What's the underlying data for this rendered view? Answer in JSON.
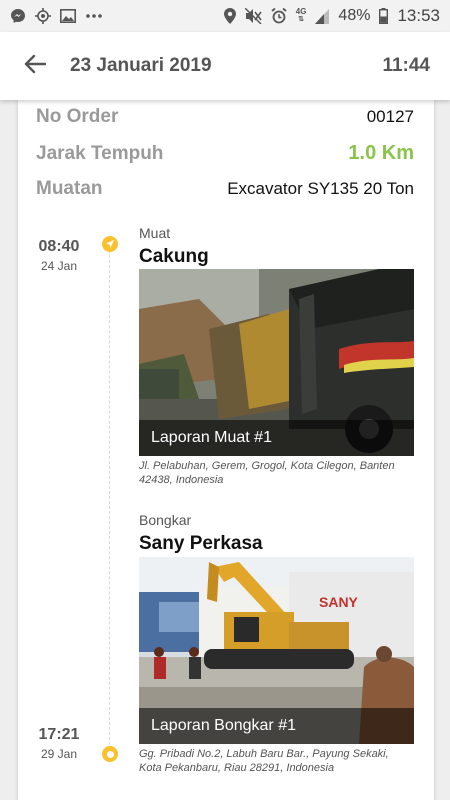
{
  "status_bar": {
    "battery_percent": "48%",
    "clock": "13:53",
    "network": "4G",
    "icons": [
      "messenger-icon",
      "location-target-icon",
      "image-icon",
      "more-dots-icon",
      "location-pin-icon",
      "mute-icon",
      "alarm-icon",
      "signal-icon",
      "battery-icon"
    ]
  },
  "header": {
    "title": "23 Januari 2019",
    "time": "11:44",
    "back_icon": "arrow-back-icon"
  },
  "order": {
    "no_order_label": "No Order",
    "no_order_value": "00127",
    "distance_label": "Jarak Tempuh",
    "distance_value": "1.0 Km",
    "cargo_label": "Muatan",
    "cargo_value": "Excavator SY135 20 Ton",
    "accent_color": "#8bc34a"
  },
  "timeline": {
    "dot_color": "#fbc02d",
    "stops": [
      {
        "time": "08:40",
        "date": "24 Jan",
        "type": "Muat",
        "name": "Cakung",
        "photo_caption": "Laporan Muat #1",
        "address": "Jl. Pelabuhan, Gerem, Grogol, Kota Cilegon, Banten 42438, Indonesia"
      },
      {
        "time": "17:21",
        "date": "29 Jan",
        "type": "Bongkar",
        "name": "Sany Perkasa",
        "photo_caption": "Laporan Bongkar #1",
        "address": "Gg. Pribadi No.2, Labuh Baru Bar., Payung Sekaki, Kota Pekanbaru, Riau 28291, Indonesia",
        "sign_text": "SANY"
      }
    ]
  }
}
